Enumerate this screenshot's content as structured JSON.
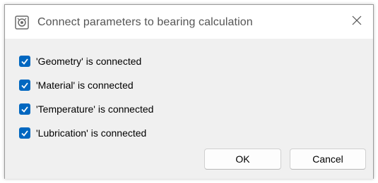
{
  "window": {
    "title": "Connect parameters to bearing calculation",
    "app_icon": "bearing-calc-icon",
    "close_icon": "close-icon"
  },
  "checks": [
    {
      "label": "'Geometry' is connected",
      "checked": true
    },
    {
      "label": "'Material' is connected",
      "checked": true
    },
    {
      "label": "'Temperature' is connected",
      "checked": true
    },
    {
      "label": "'Lubrication' is connected",
      "checked": true
    }
  ],
  "buttons": {
    "ok": "OK",
    "cancel": "Cancel"
  },
  "colors": {
    "accent": "#0067c0",
    "dialog_bg": "#f0f0f0",
    "title_bg": "#ffffff"
  }
}
